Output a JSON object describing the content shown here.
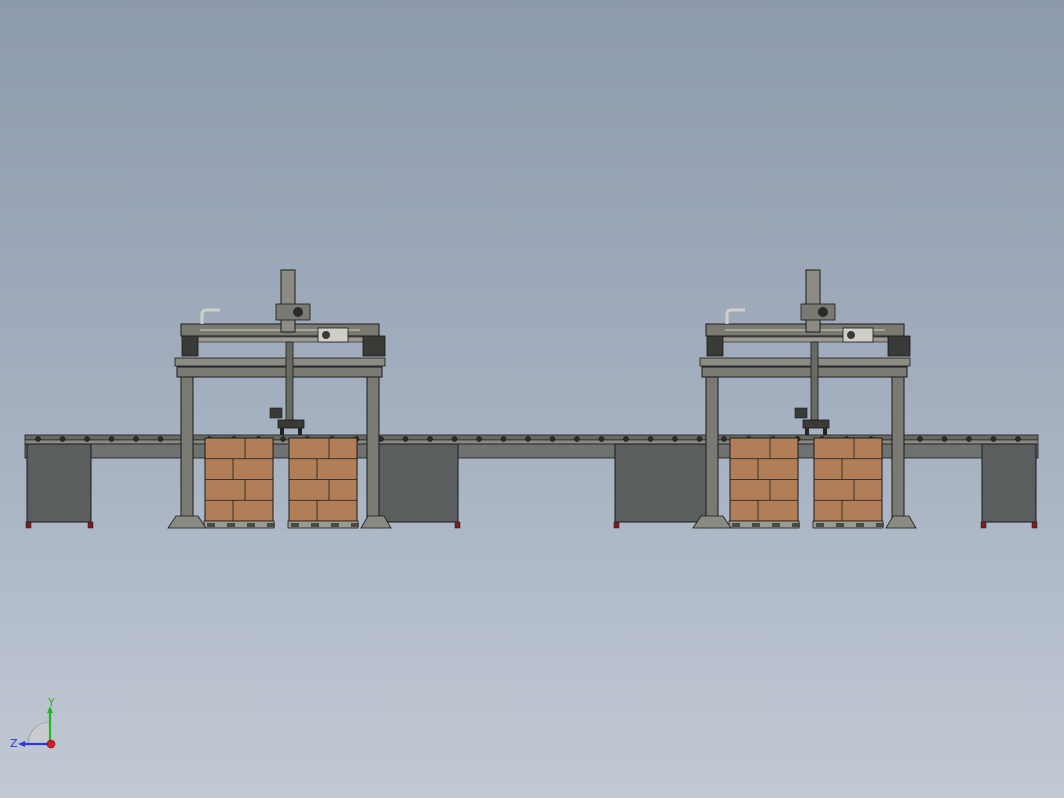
{
  "viewport": {
    "view": "front elevation",
    "background_top": "#8d9aab",
    "background_bottom": "#c2c9d4"
  },
  "model": {
    "stations": [
      {
        "name": "palletizer-gantry-left",
        "pallets": 2
      },
      {
        "name": "palletizer-gantry-right",
        "pallets": 2
      }
    ],
    "conveyor_rollers_visible": true,
    "colors": {
      "steel": "#7a7a72",
      "steel_dark": "#3a3a36",
      "cabinet": "#5a5e5e",
      "carton": "#b27e58",
      "edge": "#1a1a1a"
    }
  },
  "triad": {
    "y_label": "Y",
    "z_label": "Z",
    "y_color": "#1fb81f",
    "z_color": "#2a3cd6",
    "x_color": "#d42020"
  }
}
